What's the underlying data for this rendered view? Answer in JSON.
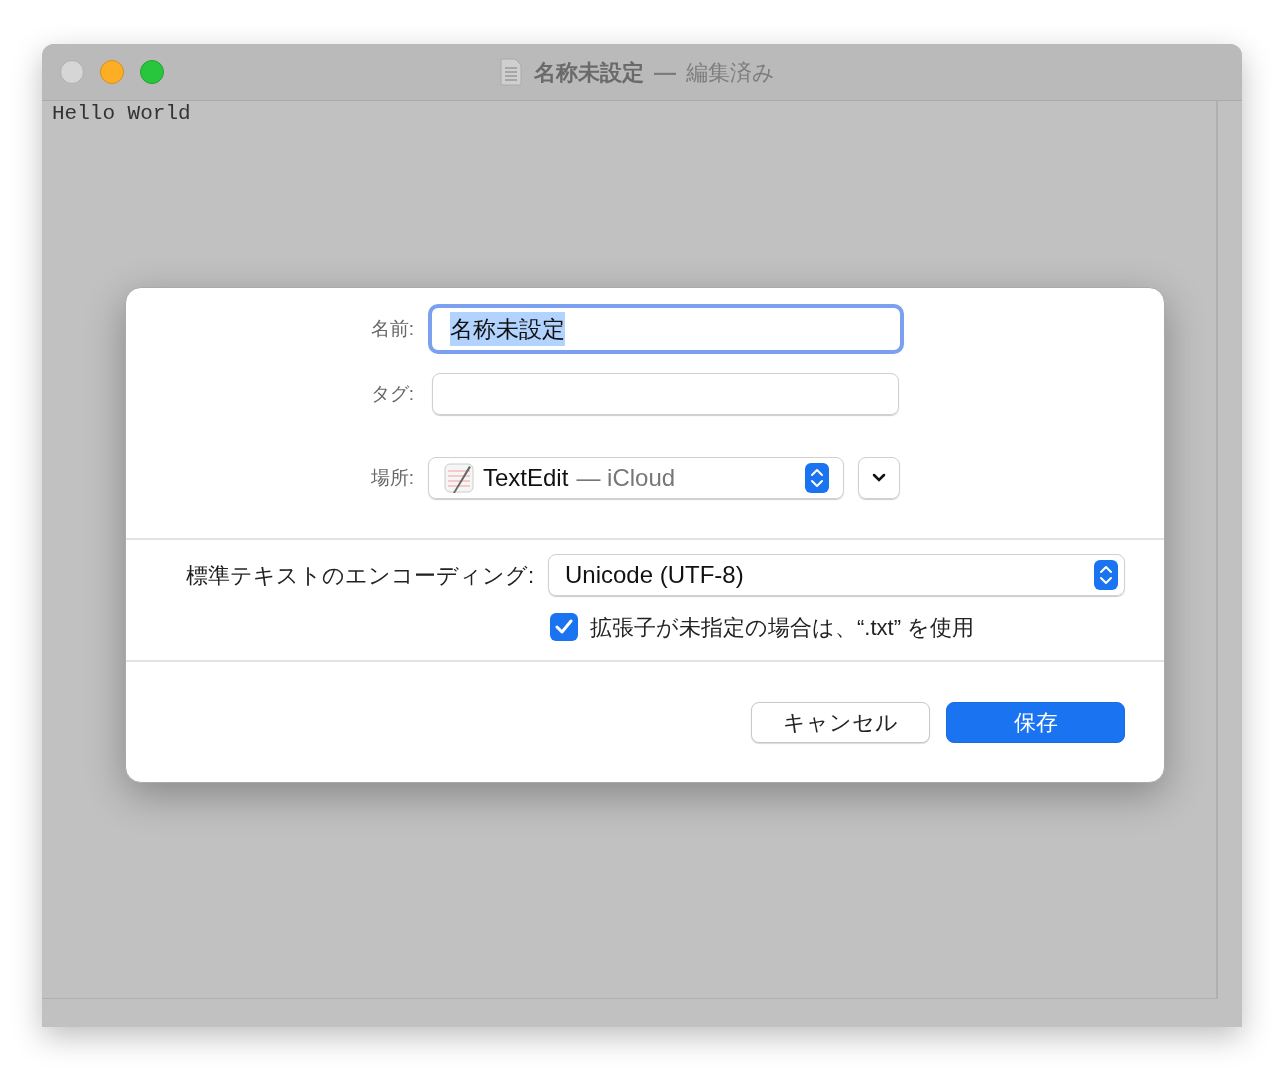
{
  "window": {
    "title": "名称未設定",
    "title_separator": "—",
    "title_status": "編集済み",
    "document_text": "Hello World"
  },
  "dialog": {
    "name": {
      "label": "名前:",
      "value": "名称未設定",
      "selected": true
    },
    "tags": {
      "label": "タグ:"
    },
    "location": {
      "label": "場所:",
      "app": "TextEdit",
      "detail": "— iCloud"
    },
    "encoding": {
      "label": "標準テキストのエンコーディング:",
      "value": "Unicode (UTF-8)"
    },
    "extension_option": {
      "label": "拡張子が未指定の場合は、“.txt” を使用",
      "checked": true
    },
    "buttons": [
      {
        "label": "キャンセル",
        "kind": "cancel"
      },
      {
        "label": "保存",
        "kind": "default"
      }
    ]
  }
}
